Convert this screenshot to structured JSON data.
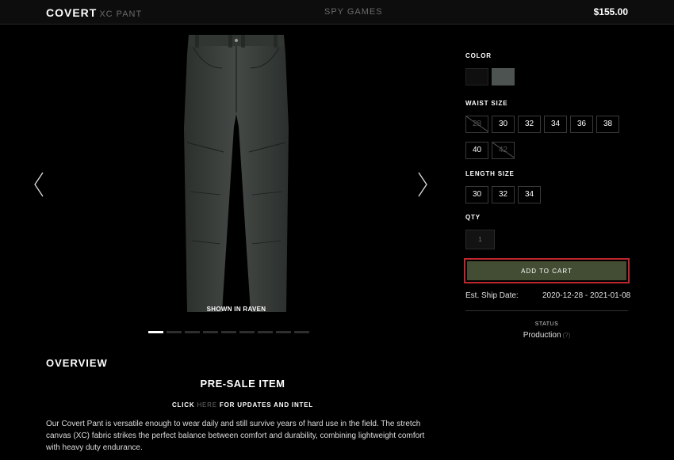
{
  "header": {
    "brand": "COVERT",
    "brand_sub": "XC PANT",
    "collection": "SPY GAMES",
    "price": "$155.00"
  },
  "gallery": {
    "caption": "SHOWN IN RAVEN",
    "prev_icon": "chevron-left-icon",
    "next_icon": "chevron-right-icon",
    "slide_count": 9,
    "active_slide": 1
  },
  "options": {
    "color_label": "COLOR",
    "colors": [
      "#0f0f0f",
      "#4c5350"
    ],
    "waist_label": "WAIST SIZE",
    "waist_sizes": [
      "28",
      "30",
      "32",
      "34",
      "36",
      "38",
      "40",
      "42"
    ],
    "waist_unavailable": [
      "28",
      "42"
    ],
    "length_label": "LENGTH SIZE",
    "length_sizes": [
      "30",
      "32",
      "34"
    ],
    "qty_label": "QTY",
    "qty_placeholder": "1"
  },
  "cart": {
    "add_label": "ADD TO CART",
    "button_color": "#434d34",
    "highlight_color": "#c0272d"
  },
  "shipping": {
    "label": "Est. Ship Date:",
    "value": "2020-12-28 - 2021-01-08"
  },
  "status": {
    "label": "STATUS",
    "value": "Production",
    "help": "(?)"
  },
  "overview": {
    "title": "OVERVIEW",
    "presale": "PRE-SALE ITEM",
    "click_prefix": "CLICK",
    "click_link": "HERE",
    "click_suffix": "FOR UPDATES AND INTEL",
    "description": "Our Covert Pant is versatile enough to wear daily and still survive years of hard use in the field. The stretch canvas (XC) fabric strikes the perfect balance between comfort and durability, combining lightweight comfort with heavy duty endurance."
  }
}
